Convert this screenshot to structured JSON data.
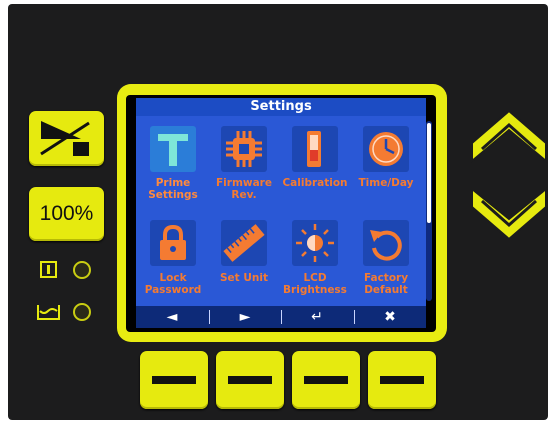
{
  "screen": {
    "title": "Settings",
    "menu": [
      {
        "label": "Prime Settings",
        "icon": "prime-t-icon",
        "selected": true
      },
      {
        "label": "Firmware Rev.",
        "icon": "chip-icon",
        "selected": false
      },
      {
        "label": "Calibration",
        "icon": "thermometer-icon",
        "selected": false
      },
      {
        "label": "Time/Day",
        "icon": "clock-icon",
        "selected": false
      },
      {
        "label": "Lock Password",
        "icon": "lock-icon",
        "selected": false
      },
      {
        "label": "Set Unit",
        "icon": "ruler-icon",
        "selected": false
      },
      {
        "label": "LCD Brightness",
        "icon": "brightness-icon",
        "selected": false
      },
      {
        "label": "Factory Default",
        "icon": "reset-icon",
        "selected": false
      }
    ],
    "nav": [
      "◄",
      "►",
      "↵",
      "✖"
    ]
  },
  "panel": {
    "percent_label": "100%",
    "colors": {
      "accent": "#e6ea0f",
      "screen_blue": "#2a58d6",
      "label_orange": "#f47b32"
    }
  }
}
